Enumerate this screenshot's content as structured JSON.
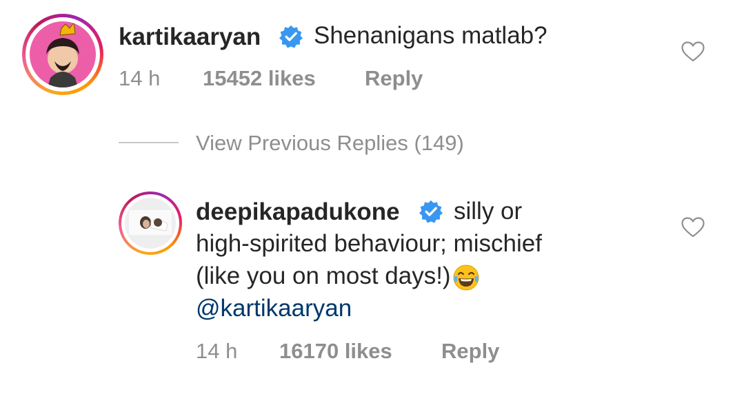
{
  "comment": {
    "username": "kartikaaryan",
    "text": "Shenanigans matlab?",
    "time": "14 h",
    "likes": "15452 likes",
    "reply_label": "Reply"
  },
  "view_previous": {
    "label": "View Previous Replies (149)"
  },
  "reply": {
    "username": "deepikapadukone",
    "line1": "silly or",
    "line2": "high-spirited behaviour; mischief",
    "line3": "(like you on most days!)",
    "emoji": "😂",
    "mention": "@kartikaaryan",
    "time": "14 h",
    "likes": "16170 likes",
    "reply_label": "Reply"
  },
  "colors": {
    "verified_badge": "#3897f0",
    "meta_text": "#8e8e8e",
    "mention": "#00376b"
  }
}
